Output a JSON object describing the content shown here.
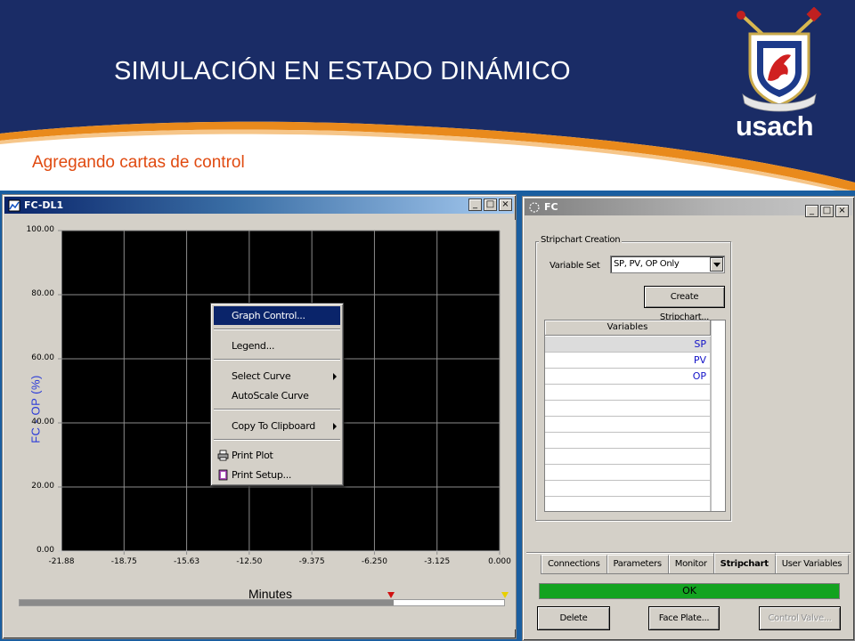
{
  "slide": {
    "title": "SIMULACIÓN EN ESTADO DINÁMICO",
    "subtitle": "Agregando cartas de control",
    "logo_text": "usach",
    "colors": {
      "header_navy": "#1a2c66",
      "accent_orange": "#e98a1c",
      "subtitle": "#e04a10"
    }
  },
  "dl1_window": {
    "title": "FC-DL1",
    "title_icon": "trend-window-icon",
    "buttons": {
      "minimize": "_",
      "maximize": "□",
      "close": "×"
    },
    "chart_data": {
      "type": "line",
      "title": "",
      "ylabel": "FC - OP (%)",
      "xlabel": "Minutes",
      "ylim": [
        0,
        100
      ],
      "xlim": [
        -21.88,
        0
      ],
      "y_ticks": [
        "100.00",
        "80.00",
        "60.00",
        "40.00",
        "20.00",
        "0.00"
      ],
      "x_ticks": [
        "-21.88",
        "-18.75",
        "-15.63",
        "-12.50",
        "-9.375",
        "-6.250",
        "-3.125",
        "0.000"
      ],
      "background": "#000000",
      "grid": true,
      "series": []
    },
    "context_menu": {
      "items": [
        {
          "label": "Graph Control...",
          "highlighted": true,
          "submenu": false,
          "icon": ""
        },
        {
          "label": "Legend...",
          "highlighted": false,
          "submenu": false,
          "icon": ""
        },
        {
          "label": "Select Curve",
          "highlighted": false,
          "submenu": true,
          "icon": ""
        },
        {
          "label": "AutoScale Curve",
          "highlighted": false,
          "submenu": false,
          "icon": ""
        },
        {
          "label": "Copy To Clipboard",
          "highlighted": false,
          "submenu": true,
          "icon": ""
        },
        {
          "label": "Print Plot",
          "highlighted": false,
          "submenu": false,
          "icon": "printer-icon"
        },
        {
          "label": "Print Setup...",
          "highlighted": false,
          "submenu": false,
          "icon": "print-setup-icon"
        }
      ]
    }
  },
  "fc_window": {
    "title": "FC",
    "title_icon": "controller-icon",
    "buttons": {
      "minimize": "_",
      "maximize": "□",
      "close": "×"
    },
    "group_label": "Stripchart Creation",
    "variable_set_label": "Variable Set",
    "variable_set_value": "SP, PV, OP Only",
    "create_button": "Create Stripchart...",
    "variables_header": "Variables",
    "variables": [
      "SP",
      "PV",
      "OP",
      "",
      "",
      "",
      "",
      "",
      "",
      "",
      ""
    ],
    "tabs": [
      {
        "label": "Connections",
        "active": false
      },
      {
        "label": "Parameters",
        "active": false
      },
      {
        "label": "Monitor",
        "active": false
      },
      {
        "label": "Stripchart",
        "active": true
      },
      {
        "label": "User Variables",
        "active": false
      }
    ],
    "status": "OK",
    "status_color": "#13a320",
    "bottom_buttons": {
      "delete": "Delete",
      "face_plate": "Face Plate...",
      "control_valve": "Control Valve..."
    }
  }
}
